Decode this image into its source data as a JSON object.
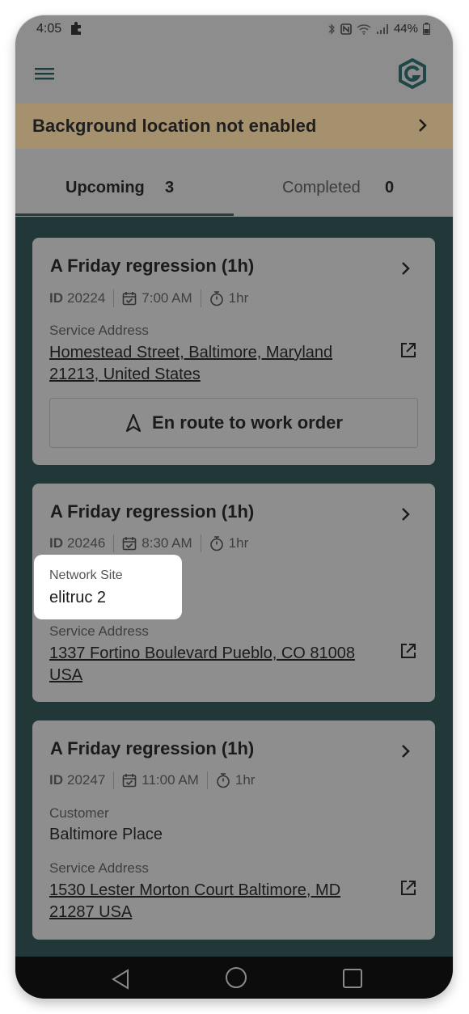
{
  "status_bar": {
    "time": "4:05",
    "battery": "44%",
    "icons": [
      "puzzle-icon",
      "bluetooth-icon",
      "nfc-icon",
      "wifi-icon",
      "signal-icon",
      "battery-icon"
    ]
  },
  "app_bar": {
    "menu_icon": "hamburger-menu-icon",
    "logo": "app-logo-icon"
  },
  "banner": {
    "text": "Background location not enabled",
    "background": "#a6916e"
  },
  "tabs": [
    {
      "label": "Upcoming",
      "count": "3",
      "selected": true
    },
    {
      "label": "Completed",
      "count": "0",
      "selected": false
    }
  ],
  "cards": [
    {
      "title": "A Friday regression (1h)",
      "id_key": "ID",
      "id_value": "20224",
      "time": "7:00 AM",
      "duration": "1hr",
      "service_label": "Service Address",
      "address": "Homestead Street, Baltimore, Maryland 21213, United States",
      "action": "En route to work order"
    },
    {
      "title": "A Friday regression (1h)",
      "id_key": "ID",
      "id_value": "20246",
      "time": "8:30 AM",
      "duration": "1hr",
      "service_label": "Service Address",
      "address": "1337 Fortino Boulevard Pueblo, CO 81008 USA"
    },
    {
      "title": "A Friday regression (1h)",
      "id_key": "ID",
      "id_value": "20247",
      "time": "11:00 AM",
      "duration": "1hr",
      "customer_label": "Customer",
      "customer": "Baltimore Place",
      "service_label": "Service Address",
      "address": "1530 Lester Morton Court Baltimore, MD 21287 USA"
    }
  ],
  "tooltip": {
    "label": "Network Site",
    "value": "elitruc 2"
  },
  "colors": {
    "content_bg": "#223838",
    "card_bg": "#8e8e8e",
    "accent": "#1f5a5a"
  }
}
